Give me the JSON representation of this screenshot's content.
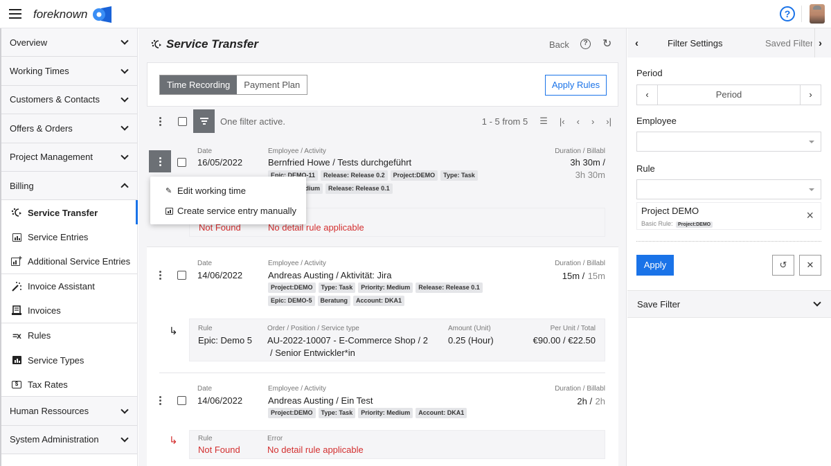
{
  "app": {
    "brand": "foreknown"
  },
  "sidebar": {
    "sections": [
      {
        "label": "Overview",
        "expanded": false
      },
      {
        "label": "Working Times",
        "expanded": false
      },
      {
        "label": "Customers & Contacts",
        "expanded": false
      },
      {
        "label": "Offers & Orders",
        "expanded": false
      },
      {
        "label": "Project Management",
        "expanded": false
      },
      {
        "label": "Billing",
        "expanded": true
      }
    ],
    "billing_items": [
      {
        "label": "Service Transfer",
        "icon": "service-transfer-icon",
        "active": true
      },
      {
        "label": "Service Entries",
        "icon": "service-entries-icon"
      },
      {
        "label": "Additional Service Entries",
        "icon": "additional-service-entries-icon"
      },
      {
        "label": "Invoice Assistant",
        "icon": "magic-wand-icon"
      },
      {
        "label": "Invoices",
        "icon": "invoice-icon"
      },
      {
        "label": "Rules",
        "icon": "rules-icon"
      },
      {
        "label": "Service Types",
        "icon": "service-types-icon"
      },
      {
        "label": "Tax Rates",
        "icon": "tax-rates-icon"
      }
    ],
    "bottom_sections": [
      {
        "label": "Human Ressources",
        "expanded": false
      },
      {
        "label": "System Administration",
        "expanded": false
      }
    ]
  },
  "page": {
    "title": "Service Transfer",
    "back_label": "Back",
    "tabs": [
      {
        "label": "Time Recording",
        "active": true
      },
      {
        "label": "Payment Plan",
        "active": false
      }
    ],
    "apply_rules_label": "Apply Rules",
    "filter_status": "One filter active.",
    "pagination": "1 - 5 from 5"
  },
  "labels": {
    "date": "Date",
    "employee_activity": "Employee / Activity",
    "duration": "Duration / Billabl",
    "rule": "Rule",
    "error": "Error",
    "order": "Order / Position / Service type",
    "amount": "Amount (Unit)",
    "per_unit": "Per Unit / Total"
  },
  "entries": [
    {
      "date": "16/05/2022",
      "employee_activity": "Bernfried Howe / Tests durchgeführt",
      "tags_row1": [
        "Epic: DEMO-11",
        "Release: Release 0.2",
        "Project:DEMO",
        "Type: Task"
      ],
      "tags_row2": [
        "Priority: Medium",
        "Release: Release 0.1"
      ],
      "duration": "3h 30m /",
      "billable": "3h 30m",
      "rule": "Not Found",
      "error": "No detail rule applicable"
    },
    {
      "date": "14/06/2022",
      "employee_activity": "Andreas Austing / Aktivität: Jira",
      "tags_row1": [
        "Project:DEMO",
        "Type: Task",
        "Priority: Medium",
        "Release: Release 0.1"
      ],
      "tags_row2": [
        "Epic: DEMO-5",
        "Beratung",
        "Account: DKA1"
      ],
      "duration": "15m /",
      "billable": "15m",
      "rule": "Epic: Demo 5",
      "order_line1": "AU-2022-10007 - E-Commerce Shop / 2",
      "order_line2": "/ Senior Entwickler*in",
      "amount": "0.25 (Hour)",
      "per_unit_total": "€90.00 / €22.50"
    },
    {
      "date": "14/06/2022",
      "employee_activity": "Andreas Austing / Ein Test",
      "tags_row1": [
        "Project:DEMO",
        "Type: Task",
        "Priority: Medium",
        "Account: DKA1"
      ],
      "duration": "2h /",
      "billable": "2h",
      "rule": "Not Found",
      "error": "No detail rule applicable"
    }
  ],
  "context_menu": {
    "items": [
      {
        "label": "Edit working time",
        "icon": "pencil-icon"
      },
      {
        "label": "Create service entry manually",
        "icon": "service-entry-icon"
      }
    ]
  },
  "filter_panel": {
    "tab_filter_settings": "Filter Settings",
    "tab_saved_filter": "Saved Filter",
    "period_label": "Period",
    "period_value": "Period",
    "employee_label": "Employee",
    "employee_value": "",
    "rule_label": "Rule",
    "rule_value": "",
    "selected_rule": {
      "name": "Project DEMO",
      "basic_label": "Basic Rule:",
      "basic_tag": "Project:DEMO"
    },
    "apply_label": "Apply",
    "save_filter_label": "Save Filter"
  },
  "colors": {
    "accent": "#1a73e8",
    "error": "#d32f2f",
    "active_tab": "#6c7075"
  }
}
